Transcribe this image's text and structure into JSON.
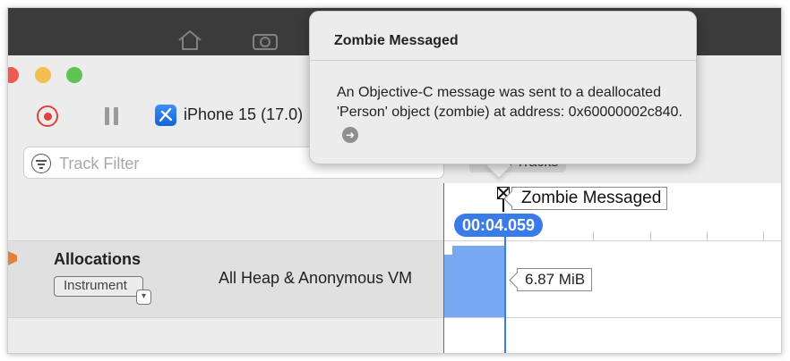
{
  "toolbar": {
    "device_label": "iPhone 15 (17.0)",
    "colors": {
      "record": "#e0413c",
      "traffic_close": "#ee5a52",
      "traffic_minimize": "#f4bd4f",
      "traffic_zoom": "#5fc454"
    }
  },
  "filter": {
    "placeholder": "Track Filter",
    "all_tracks_label": "All Tracks"
  },
  "timeline": {
    "current_time": "00:04.059",
    "event_label": "Zombie Messaged",
    "accent": "#3a7bea"
  },
  "track": {
    "name": "Allocations",
    "button_label": "Instrument",
    "subtitle": "All Heap & Anonymous VM",
    "memory_value": "6.87 MiB",
    "graph_color": "#77a9f2"
  },
  "popover": {
    "title": "Zombie Messaged",
    "message": "An Objective-C message was sent to a deallocated 'Person' object (zombie) at address: 0x60000002c840."
  }
}
